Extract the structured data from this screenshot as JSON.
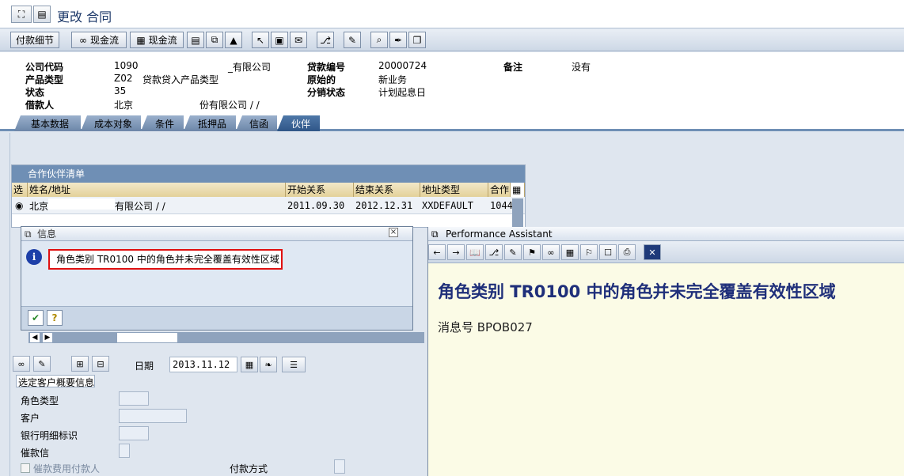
{
  "window": {
    "title": "更改 合同"
  },
  "toolbar": {
    "payment_detail": "付款细节",
    "cashflow1": "现金流",
    "cashflow2": "现金流"
  },
  "header": {
    "company_code_label": "公司代码",
    "company_code_value": "1090",
    "company_code_suffix": "_有限公司",
    "product_type_label": "产品类型",
    "product_type_value": "Z02",
    "product_type_desc": "贷款贷入产品类型",
    "status_label": "状态",
    "status_value": "35",
    "borrower_label": "借款人",
    "borrower_value": "北京",
    "borrower_suffix": "份有限公司 / /",
    "loan_no_label": "贷款编号",
    "loan_no_value": "20000724",
    "origin_label": "原始的",
    "origin_value": "新业务",
    "dist_status_label": "分销状态",
    "dist_status_value": "计划起息日",
    "remark_label": "备注",
    "remark_value": "没有"
  },
  "tabs": [
    "基本数据",
    "成本对象",
    "条件",
    "抵押品",
    "信函",
    "伙伴"
  ],
  "partner_table": {
    "title": "合作伙伴清单",
    "columns": [
      "选",
      "姓名/地址",
      "开始关系",
      "结束关系",
      "地址类型",
      "合作"
    ],
    "row": {
      "name": "北京",
      "name_suffix": "有限公司 / /",
      "start": "2011.09.30",
      "end": "2012.12.31",
      "addr_type": "XXDEFAULT",
      "partner": "1044"
    }
  },
  "info_dialog": {
    "title": "信息",
    "message": "角色类别 TR0100 中的角色并未完全覆盖有效性区域"
  },
  "lower": {
    "date_label": "日期",
    "date_value": "2013.11.12",
    "section_title": "选定客户概要信息",
    "role_type_label": "角色类型",
    "customer_label": "客户",
    "bank_detail_label": "银行明细标识",
    "dunning_label": "催款信",
    "fee_payer_label": "催款费用付款人",
    "payment_method_label": "付款方式"
  },
  "performance_assistant": {
    "title": "Performance Assistant",
    "heading": "角色类别  TR0100 中的角色并未完全覆盖有效性区域",
    "message_no": "消息号  BPOB027"
  },
  "colors": {
    "accent": "#2f5688",
    "info_border": "#e01010",
    "pa_heading": "#1f2f7a"
  }
}
